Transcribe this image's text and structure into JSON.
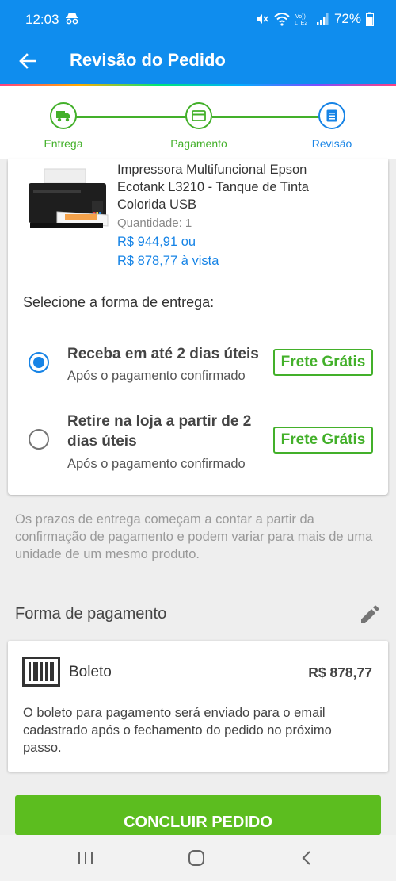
{
  "status_bar": {
    "time": "12:03",
    "battery": "72%",
    "icons": [
      "incognito-icon",
      "mute-icon",
      "wifi-icon",
      "volte-icon",
      "signal-icon",
      "battery-icon"
    ]
  },
  "app_bar": {
    "title": "Revisão do Pedido",
    "back_icon": "arrow-left-icon",
    "color": "#0f8dee"
  },
  "stepper": {
    "steps": [
      {
        "label": "Entrega",
        "icon": "truck-icon",
        "state": "done"
      },
      {
        "label": "Pagamento",
        "icon": "card-icon",
        "state": "done"
      },
      {
        "label": "Revisão",
        "icon": "document-icon",
        "state": "active"
      }
    ],
    "done_color": "#43b02a",
    "active_color": "#1784e6"
  },
  "product": {
    "name": "Impressora Multifuncional Epson Ecotank L3210 - Tanque de Tinta Colorida USB",
    "quantity": "Quantidade:  1",
    "price": "R$ 944,91 ou",
    "price_cash": "R$ 878,77 à vista"
  },
  "delivery": {
    "title": "Selecione a forma de entrega:",
    "options": [
      {
        "title": "Receba em até 2 dias úteis",
        "subtitle": "Após o pagamento confirmado",
        "badge": "Frete Grátis",
        "selected": true
      },
      {
        "title": "Retire na loja a partir de 2 dias úteis",
        "subtitle": "Após o pagamento confirmado",
        "badge": "Frete Grátis",
        "selected": false
      }
    ],
    "notice": "Os prazos de entrega começam a contar a partir da confirmação de pagamento e podem variar para mais de uma unidade de um mesmo produto."
  },
  "payment": {
    "header": "Forma de pagamento",
    "method": "Boleto",
    "amount": "R$ 878,77",
    "description": "O boleto para pagamento será enviado para o email cadastrado após o fechamento do pedido no próximo passo."
  },
  "actions": {
    "conclude": "CONCLUIR PEDIDO",
    "conclude_color": "#5cbd1f"
  }
}
